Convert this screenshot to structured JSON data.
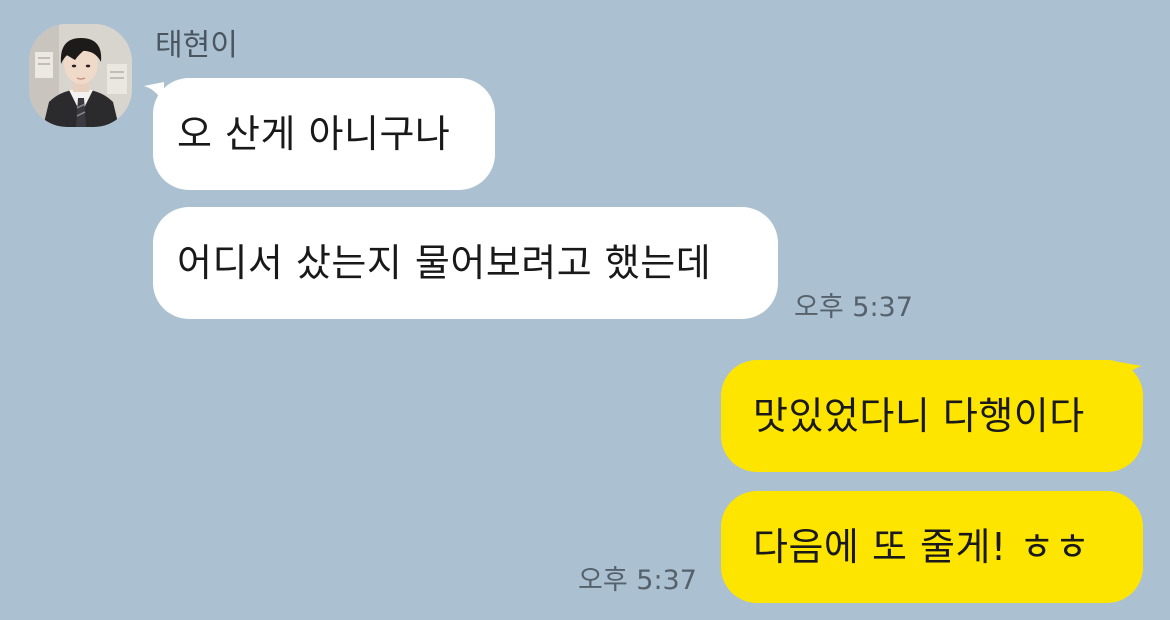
{
  "conversation": {
    "sender_name": "태현이",
    "incoming": [
      {
        "text": "오 산게 아니구나"
      },
      {
        "text": "어디서 샀는지 물어보려고 했는데"
      }
    ],
    "incoming_time": "오후 5:37",
    "outgoing": [
      {
        "text": "맛있었다니 다행이다"
      },
      {
        "text": "다음에 또 줄게! ㅎㅎ"
      }
    ],
    "outgoing_time": "오후 5:37"
  },
  "colors": {
    "background": "#abc1d1",
    "incoming_bubble": "#ffffff",
    "outgoing_bubble": "#fee500",
    "text": "#191919",
    "meta_text": "#56616b"
  },
  "icons": {
    "avatar": "profile-photo"
  }
}
